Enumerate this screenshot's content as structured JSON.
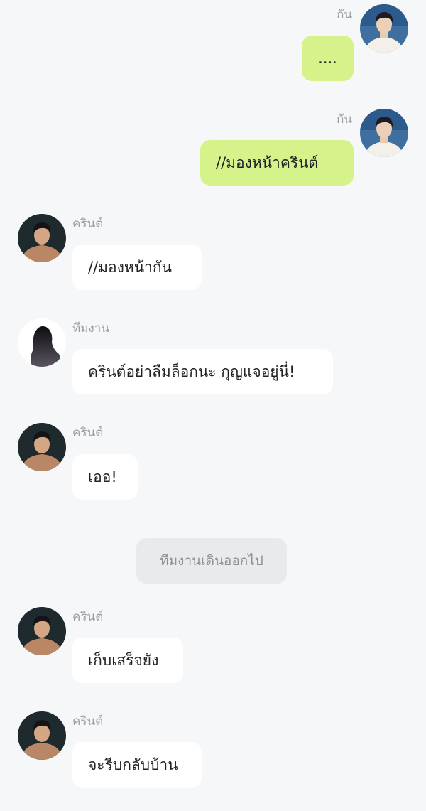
{
  "chat": {
    "messages": [
      {
        "sender": "กัน",
        "text": "....",
        "side": "right"
      },
      {
        "sender": "กัน",
        "text": "//มองหน้าครินต์",
        "side": "right"
      },
      {
        "sender": "ครินต์",
        "text": "//มองหน้ากัน",
        "side": "left"
      },
      {
        "sender": "ทีมงาน",
        "text": "ครินต์อย่าลืมล็อกนะ กุญแจอยู่นี่!",
        "side": "left"
      },
      {
        "sender": "ครินต์",
        "text": "เออ!",
        "side": "left"
      },
      {
        "sender": "ครินต์",
        "text": "เก็บเสร็จยัง",
        "side": "left"
      },
      {
        "sender": "ครินต์",
        "text": "จะรีบกลับบ้าน",
        "side": "left"
      }
    ],
    "system_notice": "ทีมงานเดินออกไป"
  },
  "colors": {
    "background": "#f6f7f9",
    "my_bubble": "#d6f38b",
    "other_bubble": "#ffffff",
    "system_bubble": "#e9eaec",
    "name_text": "#9a9ca1"
  },
  "icons": {
    "avatar_gun": "avatar-gun-icon",
    "avatar_krin": "avatar-krin-icon",
    "avatar_team": "avatar-team-silhouette-icon"
  }
}
